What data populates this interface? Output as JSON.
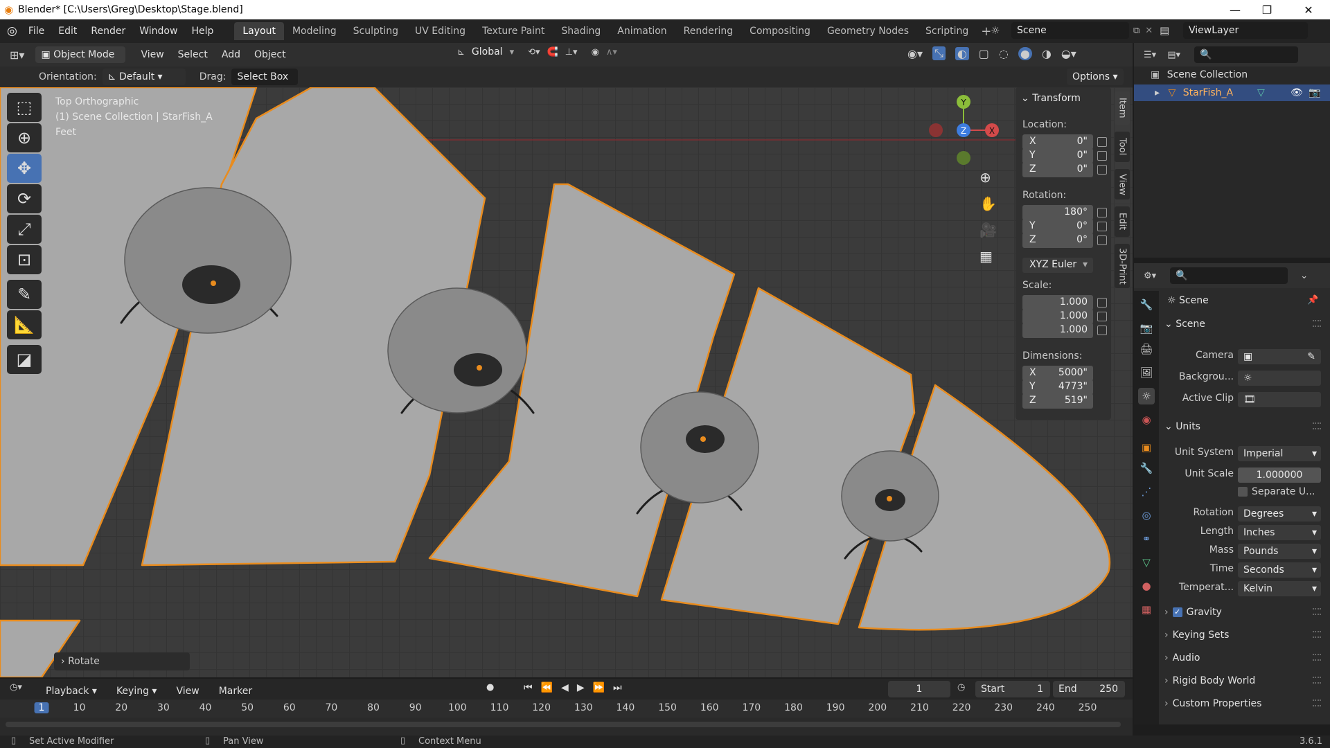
{
  "window": {
    "title": "Blender* [C:\\Users\\Greg\\Desktop\\Stage.blend]",
    "version": "3.6.1"
  },
  "menu": [
    "File",
    "Edit",
    "Render",
    "Window",
    "Help"
  ],
  "workspaces": [
    "Layout",
    "Modeling",
    "Sculpting",
    "UV Editing",
    "Texture Paint",
    "Shading",
    "Animation",
    "Rendering",
    "Compositing",
    "Geometry Nodes",
    "Scripting"
  ],
  "active_workspace": "Layout",
  "scene_name": "Scene",
  "view_layer": "ViewLayer",
  "viewport_header": {
    "mode": "Object Mode",
    "menus": [
      "View",
      "Select",
      "Add",
      "Object"
    ],
    "transform_orientation": "Global"
  },
  "tool_header": {
    "orientation_label": "Orientation:",
    "orientation_value": "Default",
    "drag_label": "Drag:",
    "drag_value": "Select Box",
    "options": "Options"
  },
  "viewport_overlay": {
    "view_name": "Top Orthographic",
    "collection_info": "(1) Scene Collection | StarFish_A",
    "units": "Feet",
    "last_op": "Rotate"
  },
  "gizmo": {
    "y": "Y",
    "z": "Z",
    "x": "X"
  },
  "transform_panel": {
    "title": "Transform",
    "location_label": "Location:",
    "location": [
      {
        "axis": "X",
        "value": "0\""
      },
      {
        "axis": "Y",
        "value": "0\""
      },
      {
        "axis": "Z",
        "value": "0\""
      }
    ],
    "rotation_label": "Rotation:",
    "rotation": [
      {
        "axis": "",
        "value": "180°"
      },
      {
        "axis": "Y",
        "value": "0°"
      },
      {
        "axis": "Z",
        "value": "0°"
      }
    ],
    "rotation_mode": "XYZ Euler",
    "scale_label": "Scale:",
    "scale": [
      "1.000",
      "1.000",
      "1.000"
    ],
    "dimensions_label": "Dimensions:",
    "dimensions": [
      {
        "axis": "X",
        "value": "5000\""
      },
      {
        "axis": "Y",
        "value": "4773\""
      },
      {
        "axis": "Z",
        "value": "519\""
      }
    ]
  },
  "n_tabs": [
    "Item",
    "Tool",
    "View",
    "Edit",
    "3D-Print"
  ],
  "outliner": {
    "root": "Scene Collection",
    "items": [
      {
        "name": "StarFish_A"
      }
    ]
  },
  "properties": {
    "context": "Scene",
    "scene_section": "Scene",
    "camera_label": "Camera",
    "background_label": "Backgrou...",
    "active_clip_label": "Active Clip",
    "units_section": "Units",
    "unit_system_label": "Unit System",
    "unit_system": "Imperial",
    "unit_scale_label": "Unit Scale",
    "unit_scale": "1.000000",
    "separate_units": "Separate U...",
    "rotation_label": "Rotation",
    "rotation": "Degrees",
    "length_label": "Length",
    "length": "Inches",
    "mass_label": "Mass",
    "mass": "Pounds",
    "time_label": "Time",
    "time": "Seconds",
    "temperature_label": "Temperat...",
    "temperature": "Kelvin",
    "collapsed_sections": [
      "Gravity",
      "Keying Sets",
      "Audio",
      "Rigid Body World",
      "Custom Properties"
    ]
  },
  "timeline": {
    "menus": [
      "Playback",
      "Keying",
      "View",
      "Marker"
    ],
    "current_frame": "1",
    "start_label": "Start",
    "start": "1",
    "end_label": "End",
    "end": "250",
    "ticks": [
      "1",
      "10",
      "20",
      "30",
      "40",
      "50",
      "60",
      "70",
      "80",
      "90",
      "100",
      "110",
      "120",
      "130",
      "140",
      "150",
      "160",
      "170",
      "180",
      "190",
      "200",
      "210",
      "220",
      "230",
      "240",
      "250"
    ]
  },
  "status_bar": {
    "left": "Set Active Modifier",
    "middle": "Pan View",
    "right": "Context Menu"
  }
}
